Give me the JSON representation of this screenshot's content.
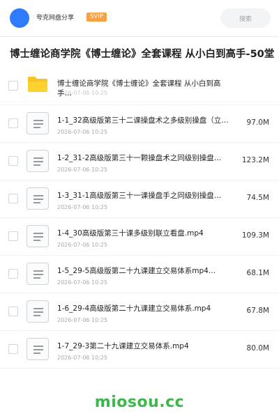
{
  "header": {
    "user_name": "夸克网盘分享",
    "badge": "SVIP",
    "search_placeholder": "搜索"
  },
  "page_title": "博士缠论商学院《博士缠论》全套课程 从小白到高手-50堂",
  "folder": {
    "name": "博士缠论商学院《博士缠论》全套课程 从小白到高手…",
    "date": "2026-07-06 10:25"
  },
  "files": [
    {
      "name": "1-1_32高级版第三十二课操盘术之多级别操盘（立…",
      "date": "2026-07-06 10:25",
      "size": "97.0M"
    },
    {
      "name": "1-2_31-2高级版第三十一颗操盘术之同级别操盘…",
      "date": "2026-07-06 10:25",
      "size": "123.2M"
    },
    {
      "name": "1-3_31-1高级版第三十一课操盘手之同级别操盘…",
      "date": "2026-07-06 10:25",
      "size": "74.5M"
    },
    {
      "name": "1-4_30高级版第三十课多级别联立看盘.mp4",
      "date": "2026-07-06 10:25",
      "size": "109.3M"
    },
    {
      "name": "1-5_29-5高级版第二十九课建立交易体系mp4…",
      "date": "2026-07-06 10:25",
      "size": "68.1M"
    },
    {
      "name": "1-6_29-4高级版第二十九课建立交易体系.mp4",
      "date": "2026-07-06 10:25",
      "size": "67.8M"
    },
    {
      "name": "1-7_29-3第二十九课建立交易体系.mp4",
      "date": "2026-07-06 10:25",
      "size": "80.0M"
    }
  ],
  "watermark": "miosou.cc",
  "colors": {
    "avatar": "#2f7bff",
    "svip_badge": "#f7a146",
    "folder": "#f9c321",
    "watermark": "#3bb84a"
  }
}
